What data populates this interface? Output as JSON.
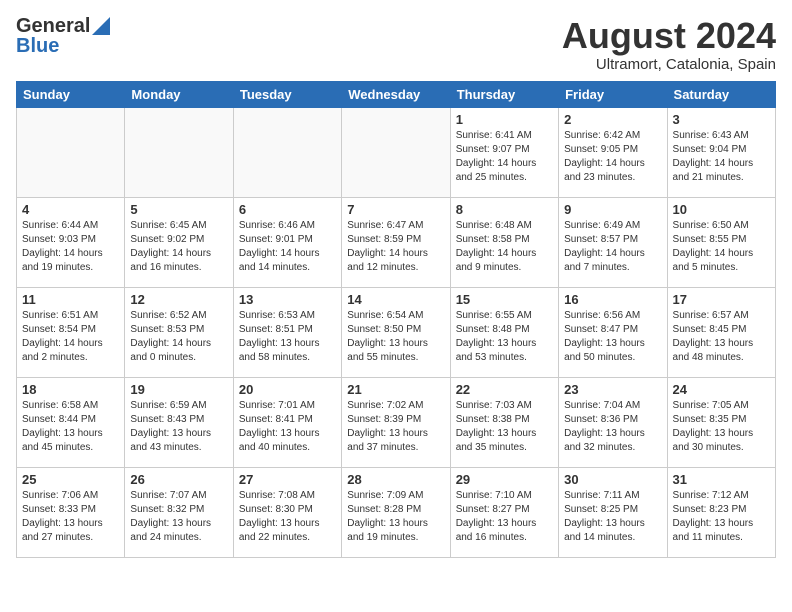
{
  "header": {
    "logo_general": "General",
    "logo_blue": "Blue",
    "month": "August 2024",
    "location": "Ultramort, Catalonia, Spain"
  },
  "days_of_week": [
    "Sunday",
    "Monday",
    "Tuesday",
    "Wednesday",
    "Thursday",
    "Friday",
    "Saturday"
  ],
  "weeks": [
    [
      {
        "day": "",
        "empty": true
      },
      {
        "day": "",
        "empty": true
      },
      {
        "day": "",
        "empty": true
      },
      {
        "day": "",
        "empty": true
      },
      {
        "day": "1",
        "sunrise": "6:41 AM",
        "sunset": "9:07 PM",
        "daylight": "14 hours and 25 minutes."
      },
      {
        "day": "2",
        "sunrise": "6:42 AM",
        "sunset": "9:05 PM",
        "daylight": "14 hours and 23 minutes."
      },
      {
        "day": "3",
        "sunrise": "6:43 AM",
        "sunset": "9:04 PM",
        "daylight": "14 hours and 21 minutes."
      }
    ],
    [
      {
        "day": "4",
        "sunrise": "6:44 AM",
        "sunset": "9:03 PM",
        "daylight": "14 hours and 19 minutes."
      },
      {
        "day": "5",
        "sunrise": "6:45 AM",
        "sunset": "9:02 PM",
        "daylight": "14 hours and 16 minutes."
      },
      {
        "day": "6",
        "sunrise": "6:46 AM",
        "sunset": "9:01 PM",
        "daylight": "14 hours and 14 minutes."
      },
      {
        "day": "7",
        "sunrise": "6:47 AM",
        "sunset": "8:59 PM",
        "daylight": "14 hours and 12 minutes."
      },
      {
        "day": "8",
        "sunrise": "6:48 AM",
        "sunset": "8:58 PM",
        "daylight": "14 hours and 9 minutes."
      },
      {
        "day": "9",
        "sunrise": "6:49 AM",
        "sunset": "8:57 PM",
        "daylight": "14 hours and 7 minutes."
      },
      {
        "day": "10",
        "sunrise": "6:50 AM",
        "sunset": "8:55 PM",
        "daylight": "14 hours and 5 minutes."
      }
    ],
    [
      {
        "day": "11",
        "sunrise": "6:51 AM",
        "sunset": "8:54 PM",
        "daylight": "14 hours and 2 minutes."
      },
      {
        "day": "12",
        "sunrise": "6:52 AM",
        "sunset": "8:53 PM",
        "daylight": "14 hours and 0 minutes."
      },
      {
        "day": "13",
        "sunrise": "6:53 AM",
        "sunset": "8:51 PM",
        "daylight": "13 hours and 58 minutes."
      },
      {
        "day": "14",
        "sunrise": "6:54 AM",
        "sunset": "8:50 PM",
        "daylight": "13 hours and 55 minutes."
      },
      {
        "day": "15",
        "sunrise": "6:55 AM",
        "sunset": "8:48 PM",
        "daylight": "13 hours and 53 minutes."
      },
      {
        "day": "16",
        "sunrise": "6:56 AM",
        "sunset": "8:47 PM",
        "daylight": "13 hours and 50 minutes."
      },
      {
        "day": "17",
        "sunrise": "6:57 AM",
        "sunset": "8:45 PM",
        "daylight": "13 hours and 48 minutes."
      }
    ],
    [
      {
        "day": "18",
        "sunrise": "6:58 AM",
        "sunset": "8:44 PM",
        "daylight": "13 hours and 45 minutes."
      },
      {
        "day": "19",
        "sunrise": "6:59 AM",
        "sunset": "8:43 PM",
        "daylight": "13 hours and 43 minutes."
      },
      {
        "day": "20",
        "sunrise": "7:01 AM",
        "sunset": "8:41 PM",
        "daylight": "13 hours and 40 minutes."
      },
      {
        "day": "21",
        "sunrise": "7:02 AM",
        "sunset": "8:39 PM",
        "daylight": "13 hours and 37 minutes."
      },
      {
        "day": "22",
        "sunrise": "7:03 AM",
        "sunset": "8:38 PM",
        "daylight": "13 hours and 35 minutes."
      },
      {
        "day": "23",
        "sunrise": "7:04 AM",
        "sunset": "8:36 PM",
        "daylight": "13 hours and 32 minutes."
      },
      {
        "day": "24",
        "sunrise": "7:05 AM",
        "sunset": "8:35 PM",
        "daylight": "13 hours and 30 minutes."
      }
    ],
    [
      {
        "day": "25",
        "sunrise": "7:06 AM",
        "sunset": "8:33 PM",
        "daylight": "13 hours and 27 minutes."
      },
      {
        "day": "26",
        "sunrise": "7:07 AM",
        "sunset": "8:32 PM",
        "daylight": "13 hours and 24 minutes."
      },
      {
        "day": "27",
        "sunrise": "7:08 AM",
        "sunset": "8:30 PM",
        "daylight": "13 hours and 22 minutes."
      },
      {
        "day": "28",
        "sunrise": "7:09 AM",
        "sunset": "8:28 PM",
        "daylight": "13 hours and 19 minutes."
      },
      {
        "day": "29",
        "sunrise": "7:10 AM",
        "sunset": "8:27 PM",
        "daylight": "13 hours and 16 minutes."
      },
      {
        "day": "30",
        "sunrise": "7:11 AM",
        "sunset": "8:25 PM",
        "daylight": "13 hours and 14 minutes."
      },
      {
        "day": "31",
        "sunrise": "7:12 AM",
        "sunset": "8:23 PM",
        "daylight": "13 hours and 11 minutes."
      }
    ]
  ],
  "labels": {
    "sunrise": "Sunrise:",
    "sunset": "Sunset:",
    "daylight": "Daylight:"
  }
}
